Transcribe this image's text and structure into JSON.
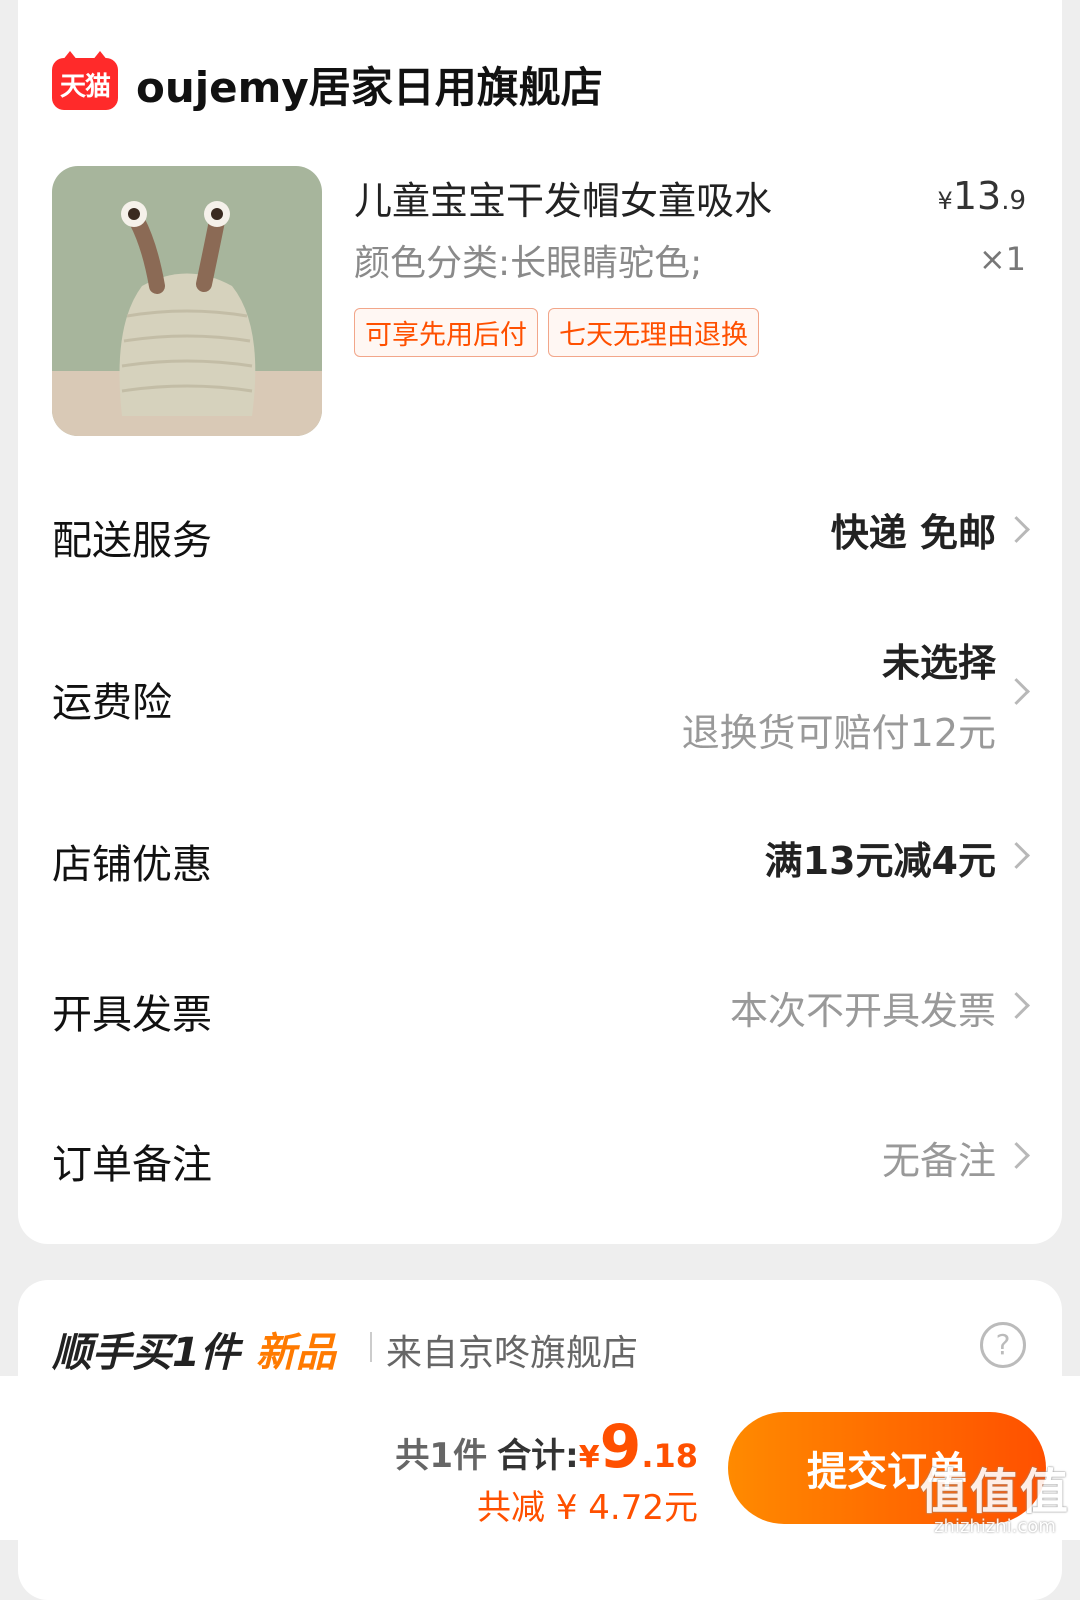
{
  "store": {
    "badge": "天猫",
    "name": "oujemy居家日用旗舰店"
  },
  "product": {
    "title": "儿童宝宝干发帽女童吸水",
    "variant": "颜色分类:长眼睛驼色;",
    "price_currency": "¥",
    "price_int": "13",
    "price_dec": ".9",
    "qty": "×1",
    "tags": [
      "可享先用后付",
      "七天无理由退换"
    ]
  },
  "rows": {
    "delivery": {
      "label": "配送服务",
      "value": "快递 免邮"
    },
    "insurance": {
      "label": "运费险",
      "value": "未选择",
      "sub": "退换货可赔付12元"
    },
    "coupon": {
      "label": "店铺优惠",
      "value": "满13元减4元"
    },
    "invoice": {
      "label": "开具发票",
      "value": "本次不开具发票"
    },
    "note": {
      "label": "订单备注",
      "value": "无备注"
    }
  },
  "addon": {
    "title": "顺手买1件",
    "highlight": "新品",
    "source": "来自京咚旗舰店",
    "help_icon": "question-circle-icon"
  },
  "footer": {
    "count": "共1件",
    "total_label": "合计:",
    "total_currency": "¥",
    "total_int": "9",
    "total_dec": ".18",
    "discount": "共减 ¥ 4.72元",
    "submit": "提交订单"
  },
  "watermark": {
    "main": "值值值",
    "sub": "zhizhizhi.com"
  },
  "colors": {
    "accent": "#ff5000",
    "tmall": "#ff2a2a",
    "background": "#eeeeee"
  }
}
